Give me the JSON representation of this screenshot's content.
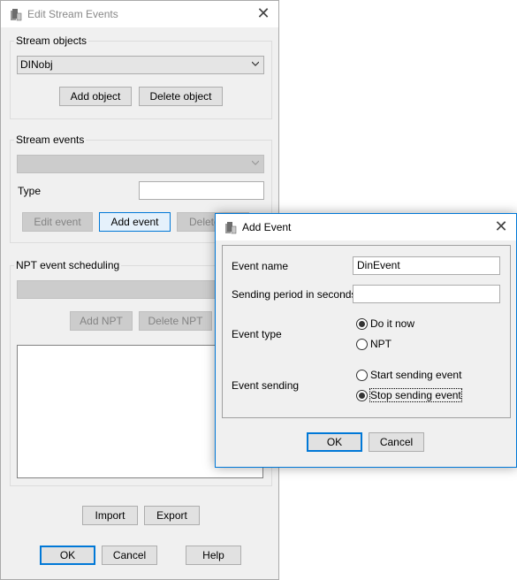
{
  "edit_window": {
    "title": "Edit Stream Events",
    "stream_objects": {
      "group_label": "Stream objects",
      "selected_object": "DINobj",
      "add_label": "Add object",
      "delete_label": "Delete object"
    },
    "stream_events": {
      "group_label": "Stream events",
      "selected_event": "",
      "type_label": "Type",
      "type_value": "",
      "edit_label": "Edit event",
      "add_label": "Add event",
      "delete_label": "Delete"
    },
    "npt": {
      "group_label": "NPT event scheduling",
      "add_label": "Add NPT",
      "delete_label": "Delete NPT"
    },
    "import_label": "Import",
    "export_label": "Export",
    "ok_label": "OK",
    "cancel_label": "Cancel",
    "help_label": "Help"
  },
  "add_event": {
    "title": "Add Event",
    "event_name_label": "Event name",
    "event_name_value": "DinEvent",
    "sending_period_label": "Sending period in seconds",
    "sending_period_value": "",
    "event_type_label": "Event type",
    "event_type_options": [
      "Do it now",
      "NPT"
    ],
    "event_type_selected": "Do it now",
    "event_sending_label": "Event sending",
    "event_sending_options": [
      "Start sending event",
      "Stop sending event"
    ],
    "event_sending_selected": "Stop sending event",
    "ok_label": "OK",
    "cancel_label": "Cancel"
  },
  "icons": {
    "app": "app-icon",
    "close": "close-icon",
    "dropdown": "chevron-down-icon"
  }
}
